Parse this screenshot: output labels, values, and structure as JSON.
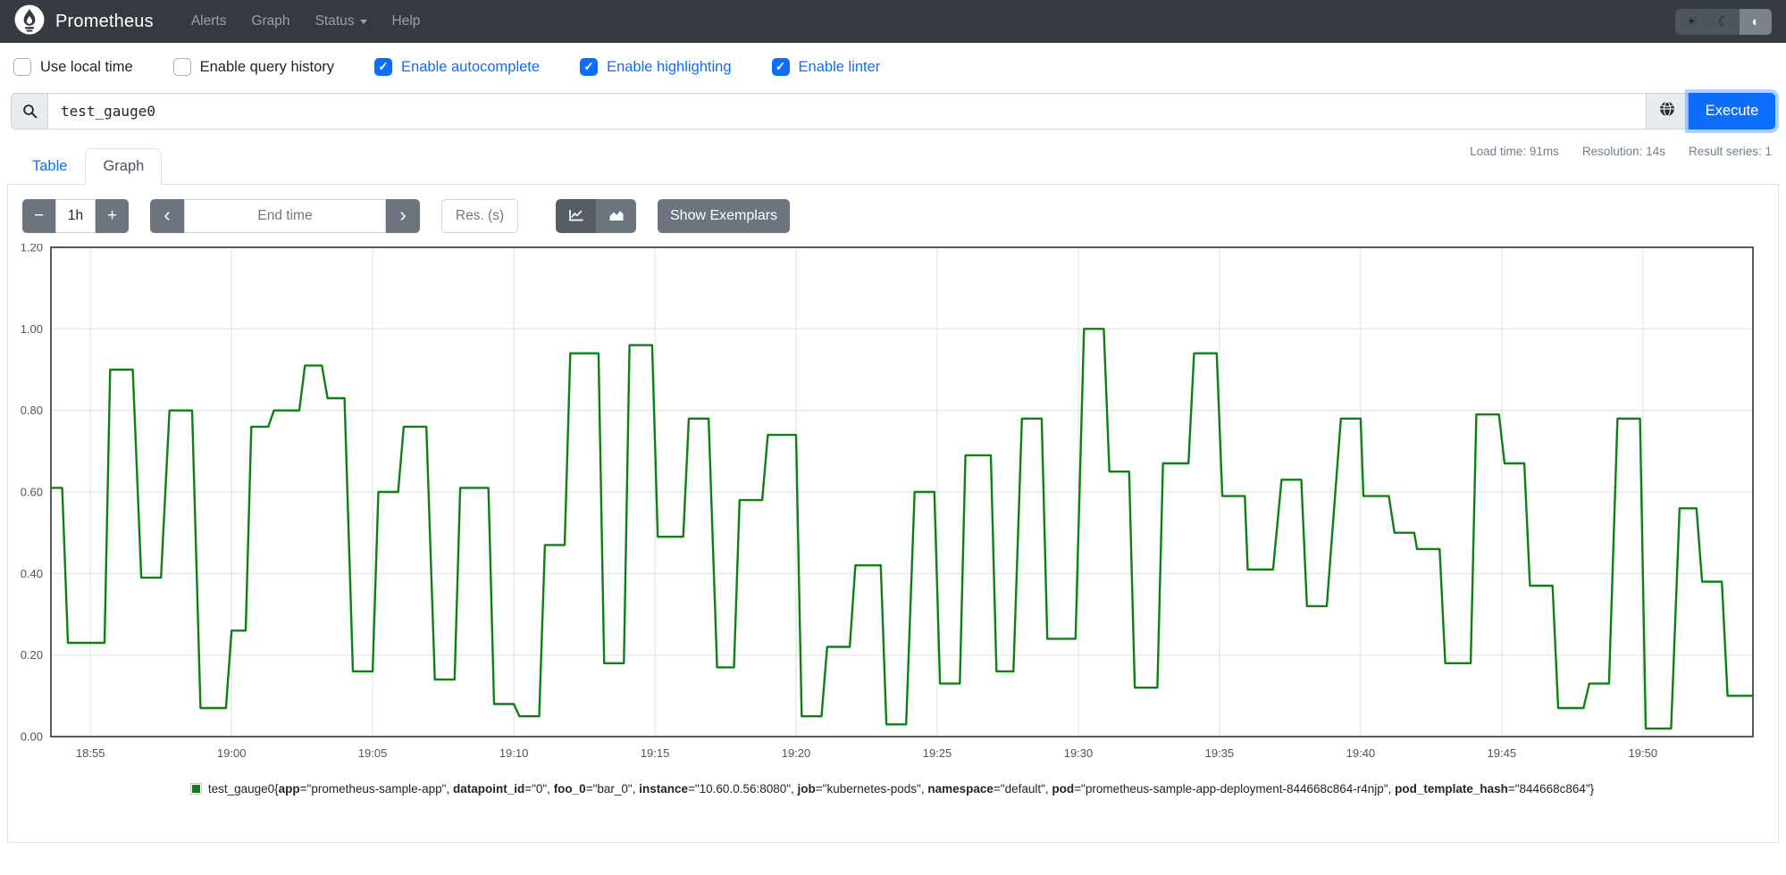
{
  "navbar": {
    "brand": "Prometheus",
    "links": [
      {
        "label": "Alerts"
      },
      {
        "label": "Graph"
      },
      {
        "label": "Status",
        "has_dropdown": true
      },
      {
        "label": "Help"
      }
    ],
    "theme_buttons": [
      {
        "name": "light",
        "icon": "sun-icon",
        "glyph": "☀",
        "active": false
      },
      {
        "name": "dark",
        "icon": "moon-icon",
        "glyph": "☾",
        "active": false
      },
      {
        "name": "auto",
        "icon": "contrast-icon",
        "glyph": "◐",
        "active": true
      }
    ],
    "colors": {
      "background": "#343a40",
      "brand_text": "#ffffff",
      "link_text": "#9aa1a8"
    }
  },
  "options_bar": {
    "check_glyph": "✓",
    "checkboxes": [
      {
        "label": "Use local time",
        "checked": false
      },
      {
        "label": "Enable query history",
        "checked": false
      },
      {
        "label": "Enable autocomplete",
        "checked": true
      },
      {
        "label": "Enable highlighting",
        "checked": true
      },
      {
        "label": "Enable linter",
        "checked": true
      }
    ]
  },
  "query_bar": {
    "value": "test_gauge0",
    "execute_label": "Execute",
    "icons": [
      "search-icon",
      "globe-icon"
    ],
    "accent_color": "#0d6efd"
  },
  "stats": {
    "load_time": "Load time: 91ms",
    "resolution": "Resolution: 14s",
    "result_series": "Result series: 1"
  },
  "tabs": [
    {
      "label": "Table",
      "active": false
    },
    {
      "label": "Graph",
      "active": true
    }
  ],
  "graph_controls": {
    "minus_label": "−",
    "range_value": "1h",
    "plus_label": "+",
    "prev_label": "‹",
    "next_label": "›",
    "end_time_placeholder": "End time",
    "res_placeholder": "Res. (s)",
    "show_exemplars_label": "Show Exemplars",
    "chart_type_icons": [
      "line-chart-icon",
      "area-chart-icon"
    ],
    "active_chart_type": "line"
  },
  "chart_data": {
    "type": "line",
    "title": "",
    "xlabel": "",
    "ylabel": "",
    "grid": true,
    "legend_position": "bottom",
    "x_axis": {
      "unit": "time of day",
      "reference": "minutes after 18:50",
      "domain_minutes": [
        3.6,
        63.9
      ],
      "tick_minutes": [
        5,
        10,
        15,
        20,
        25,
        30,
        35,
        40,
        45,
        50,
        55,
        60
      ],
      "ticks": [
        "18:55",
        "19:00",
        "19:05",
        "19:10",
        "19:15",
        "19:20",
        "19:25",
        "19:30",
        "19:35",
        "19:40",
        "19:45",
        "19:50"
      ]
    },
    "y_axis": {
      "range": [
        0,
        1.2
      ],
      "tick_values": [
        0,
        0.2,
        0.4,
        0.6,
        0.8,
        1.0,
        1.2
      ],
      "ticks": [
        "0.00",
        "0.20",
        "0.40",
        "0.60",
        "0.80",
        "1.00",
        "1.20"
      ]
    },
    "series": [
      {
        "name": "test_gauge0",
        "color": "#0e8014",
        "plateaus": [
          [
            3.6,
            4.0,
            0.61
          ],
          [
            4.2,
            5.5,
            0.23
          ],
          [
            5.7,
            6.5,
            0.9
          ],
          [
            6.8,
            7.5,
            0.39
          ],
          [
            7.8,
            8.6,
            0.8
          ],
          [
            8.9,
            9.8,
            0.07
          ],
          [
            10.0,
            10.5,
            0.26
          ],
          [
            10.7,
            11.3,
            0.76
          ],
          [
            11.5,
            12.4,
            0.8
          ],
          [
            12.6,
            13.2,
            0.91
          ],
          [
            13.4,
            14.0,
            0.83
          ],
          [
            14.3,
            15.0,
            0.16
          ],
          [
            15.2,
            15.9,
            0.6
          ],
          [
            16.1,
            16.9,
            0.76
          ],
          [
            17.2,
            17.9,
            0.14
          ],
          [
            18.1,
            19.1,
            0.61
          ],
          [
            19.3,
            20.0,
            0.08
          ],
          [
            20.2,
            20.9,
            0.05
          ],
          [
            21.1,
            21.8,
            0.47
          ],
          [
            22.0,
            23.0,
            0.94
          ],
          [
            23.2,
            23.9,
            0.18
          ],
          [
            24.1,
            24.9,
            0.96
          ],
          [
            25.1,
            26.0,
            0.49
          ],
          [
            26.2,
            26.9,
            0.78
          ],
          [
            27.2,
            27.8,
            0.17
          ],
          [
            28.0,
            28.8,
            0.58
          ],
          [
            29.0,
            30.0,
            0.74
          ],
          [
            30.2,
            30.9,
            0.05
          ],
          [
            31.1,
            31.9,
            0.22
          ],
          [
            32.1,
            33.0,
            0.42
          ],
          [
            33.2,
            33.9,
            0.03
          ],
          [
            34.2,
            34.9,
            0.6
          ],
          [
            35.1,
            35.8,
            0.13
          ],
          [
            36.0,
            36.9,
            0.69
          ],
          [
            37.1,
            37.7,
            0.16
          ],
          [
            38.0,
            38.7,
            0.78
          ],
          [
            38.9,
            39.9,
            0.24
          ],
          [
            40.2,
            40.9,
            1.0
          ],
          [
            41.1,
            41.8,
            0.65
          ],
          [
            42.0,
            42.8,
            0.12
          ],
          [
            43.0,
            43.9,
            0.67
          ],
          [
            44.1,
            44.9,
            0.94
          ],
          [
            45.1,
            45.9,
            0.59
          ],
          [
            46.0,
            46.9,
            0.41
          ],
          [
            47.2,
            47.9,
            0.63
          ],
          [
            48.1,
            48.8,
            0.32
          ],
          [
            49.3,
            50.0,
            0.78
          ],
          [
            50.1,
            51.0,
            0.59
          ],
          [
            51.2,
            51.9,
            0.5
          ],
          [
            52.0,
            52.8,
            0.46
          ],
          [
            53.0,
            53.9,
            0.18
          ],
          [
            54.1,
            54.9,
            0.79
          ],
          [
            55.1,
            55.8,
            0.67
          ],
          [
            56.0,
            56.8,
            0.37
          ],
          [
            57.0,
            57.9,
            0.07
          ],
          [
            58.1,
            58.8,
            0.13
          ],
          [
            59.1,
            59.9,
            0.78
          ],
          [
            60.1,
            61.0,
            0.02
          ],
          [
            61.3,
            61.9,
            0.56
          ],
          [
            62.1,
            62.8,
            0.38
          ],
          [
            63.0,
            63.9,
            0.1
          ]
        ]
      }
    ]
  },
  "legend": {
    "series_name": "test_gauge0",
    "swatch_color": "#0e8014",
    "labels": [
      {
        "key": "app",
        "value": "prometheus-sample-app"
      },
      {
        "key": "datapoint_id",
        "value": "0"
      },
      {
        "key": "foo_0",
        "value": "bar_0"
      },
      {
        "key": "instance",
        "value": "10.60.0.56:8080"
      },
      {
        "key": "job",
        "value": "kubernetes-pods"
      },
      {
        "key": "namespace",
        "value": "default"
      },
      {
        "key": "pod",
        "value": "prometheus-sample-app-deployment-844668c864-r4njp"
      },
      {
        "key": "pod_template_hash",
        "value": "844668c864"
      }
    ]
  }
}
